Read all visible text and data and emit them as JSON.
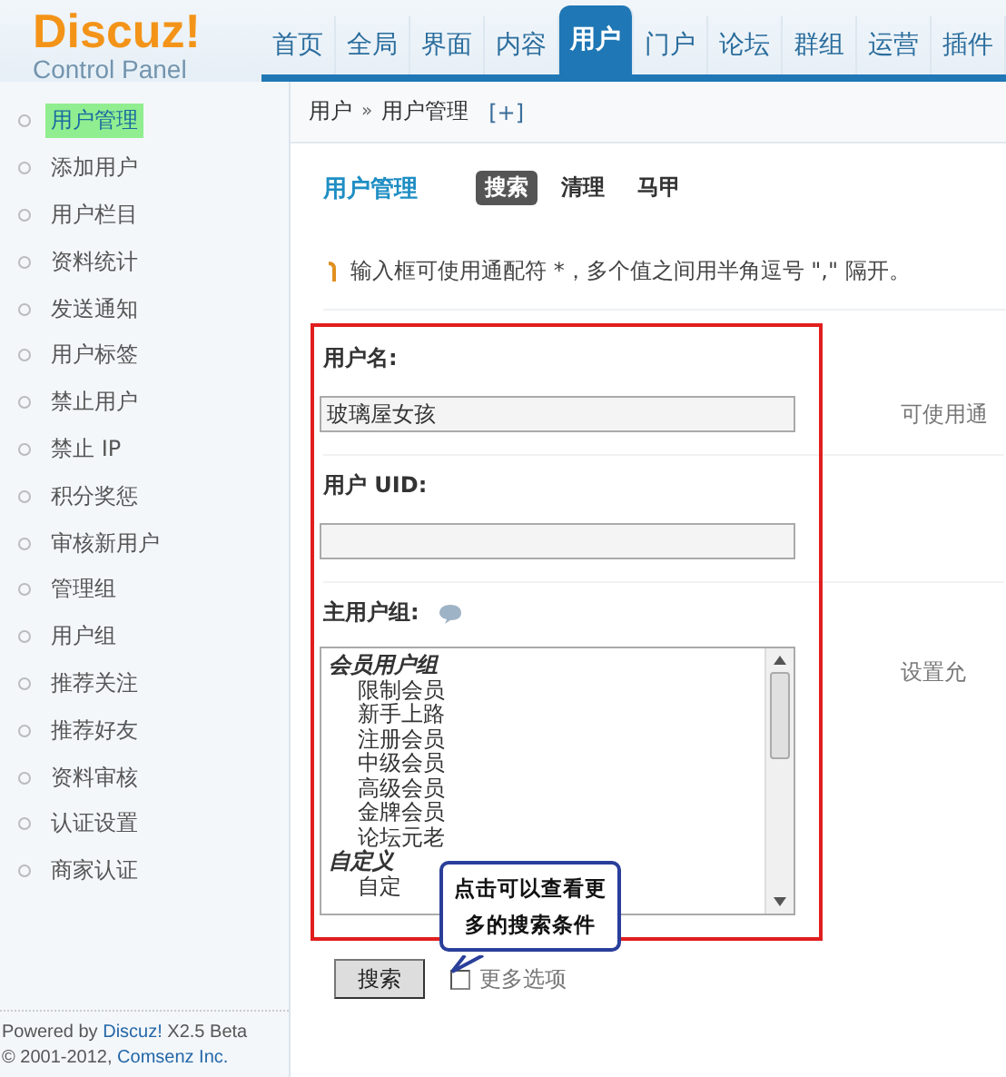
{
  "logo": {
    "name": "Discuz!",
    "subtitle": "Control Panel"
  },
  "nav": [
    {
      "label": "首页",
      "selected": false
    },
    {
      "label": "全局",
      "selected": false
    },
    {
      "label": "界面",
      "selected": false
    },
    {
      "label": "内容",
      "selected": false
    },
    {
      "label": "用户",
      "selected": true
    },
    {
      "label": "门户",
      "selected": false
    },
    {
      "label": "论坛",
      "selected": false
    },
    {
      "label": "群组",
      "selected": false
    },
    {
      "label": "运营",
      "selected": false
    },
    {
      "label": "插件",
      "selected": false
    }
  ],
  "breadcrumb": {
    "items": [
      "用户",
      "用户管理"
    ],
    "separator": "»",
    "add": "[+]"
  },
  "sidebar": {
    "items": [
      {
        "label": "用户管理",
        "selected": true
      },
      {
        "label": "添加用户",
        "selected": false
      },
      {
        "label": "用户栏目",
        "selected": false
      },
      {
        "label": "资料统计",
        "selected": false
      },
      {
        "label": "发送通知",
        "selected": false
      },
      {
        "label": "用户标签",
        "selected": false
      },
      {
        "label": "禁止用户",
        "selected": false
      },
      {
        "label": "禁止 IP",
        "selected": false
      },
      {
        "label": "积分奖惩",
        "selected": false
      },
      {
        "label": "审核新用户",
        "selected": false
      },
      {
        "label": "管理组",
        "selected": false
      },
      {
        "label": "用户组",
        "selected": false
      },
      {
        "label": "推荐关注",
        "selected": false
      },
      {
        "label": "推荐好友",
        "selected": false
      },
      {
        "label": "资料审核",
        "selected": false
      },
      {
        "label": "认证设置",
        "selected": false
      },
      {
        "label": "商家认证",
        "selected": false
      }
    ],
    "footer": [
      {
        "before": "Powered by ",
        "link": "Discuz!",
        "after": " X2.5 Beta"
      },
      {
        "before": "© 2001-2012, ",
        "link": "Comsenz Inc."
      }
    ]
  },
  "page_title": "用户管理",
  "subtabs": [
    {
      "label": "搜索",
      "selected": true
    },
    {
      "label": "清理",
      "selected": false
    },
    {
      "label": "马甲",
      "selected": false
    }
  ],
  "tip": "输入框可使用通配符 *，多个值之间用半角逗号 \",\" 隔开。",
  "form": {
    "username": {
      "label": "用户名:",
      "value": "玻璃屋女孩",
      "hint": "可使用通"
    },
    "uid": {
      "label": "用户 UID:"
    },
    "group": {
      "label": "主用户组:",
      "hint": "设置允",
      "options": [
        {
          "kind": "group",
          "label": "会员用户组"
        },
        {
          "kind": "option",
          "label": "限制会员"
        },
        {
          "kind": "option",
          "label": "新手上路"
        },
        {
          "kind": "option",
          "label": "注册会员"
        },
        {
          "kind": "option",
          "label": "中级会员"
        },
        {
          "kind": "option",
          "label": "高级会员"
        },
        {
          "kind": "option",
          "label": "金牌会员"
        },
        {
          "kind": "option",
          "label": "论坛元老"
        },
        {
          "kind": "group",
          "label": "自定义"
        },
        {
          "kind": "option",
          "label": "自定"
        }
      ]
    }
  },
  "callout": "点击可以查看更多的搜索条件",
  "search_button": "搜索",
  "more_options": {
    "label": "更多选项",
    "checked": false
  }
}
